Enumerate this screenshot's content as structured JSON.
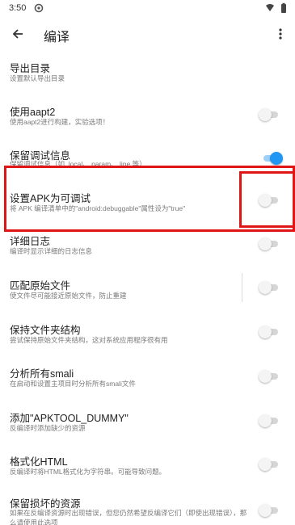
{
  "status_bar": {
    "time": "3:50"
  },
  "app_bar": {
    "title": "编译"
  },
  "items": [
    {
      "title": "导出目录",
      "summary": "设置默认导出目录",
      "has_toggle": false
    },
    {
      "title": "使用aapt2",
      "summary": "使用aapt2进行构建，实验选项！",
      "toggle_on": false
    },
    {
      "title": "保留调试信息",
      "summary": "保留调试信息（如 .local、.param、.line 等）",
      "toggle_on": true
    },
    {
      "title": "设置APK为可调试",
      "summary": "将 APK 编译清单中的\"android:debuggable\"属性设为\"true\"",
      "toggle_on": false
    },
    {
      "title": "详细日志",
      "summary": "编译时显示详细的日志信息",
      "toggle_on": false
    },
    {
      "title": "匹配原始文件",
      "summary": "使文件尽可能接近原始文件，防止重建",
      "toggle_on": false
    },
    {
      "title": "保持文件夹结构",
      "summary": "尝试保持原始文件夹结构，这对系统应用程序很有用",
      "toggle_on": false
    },
    {
      "title": "分析所有smali",
      "summary": "在启动和设置主项目时分析所有smali文件",
      "toggle_on": false
    },
    {
      "title": "添加\"APKTOOL_DUMMY\"",
      "summary": "反编译时添加缺少的资源",
      "toggle_on": false
    },
    {
      "title": "格式化HTML",
      "summary": "反编译时将HTML格式化为字符串。可能导致问题。",
      "toggle_on": false
    },
    {
      "title": "保留损坏的资源",
      "summary": "如果在反编译资源时出现错误，但您仍然希望反编译它们（即使出现错误），那么请使用此选项",
      "toggle_on": false
    }
  ],
  "colors": {
    "accent": "#2196f3",
    "highlight": "#e01616"
  }
}
